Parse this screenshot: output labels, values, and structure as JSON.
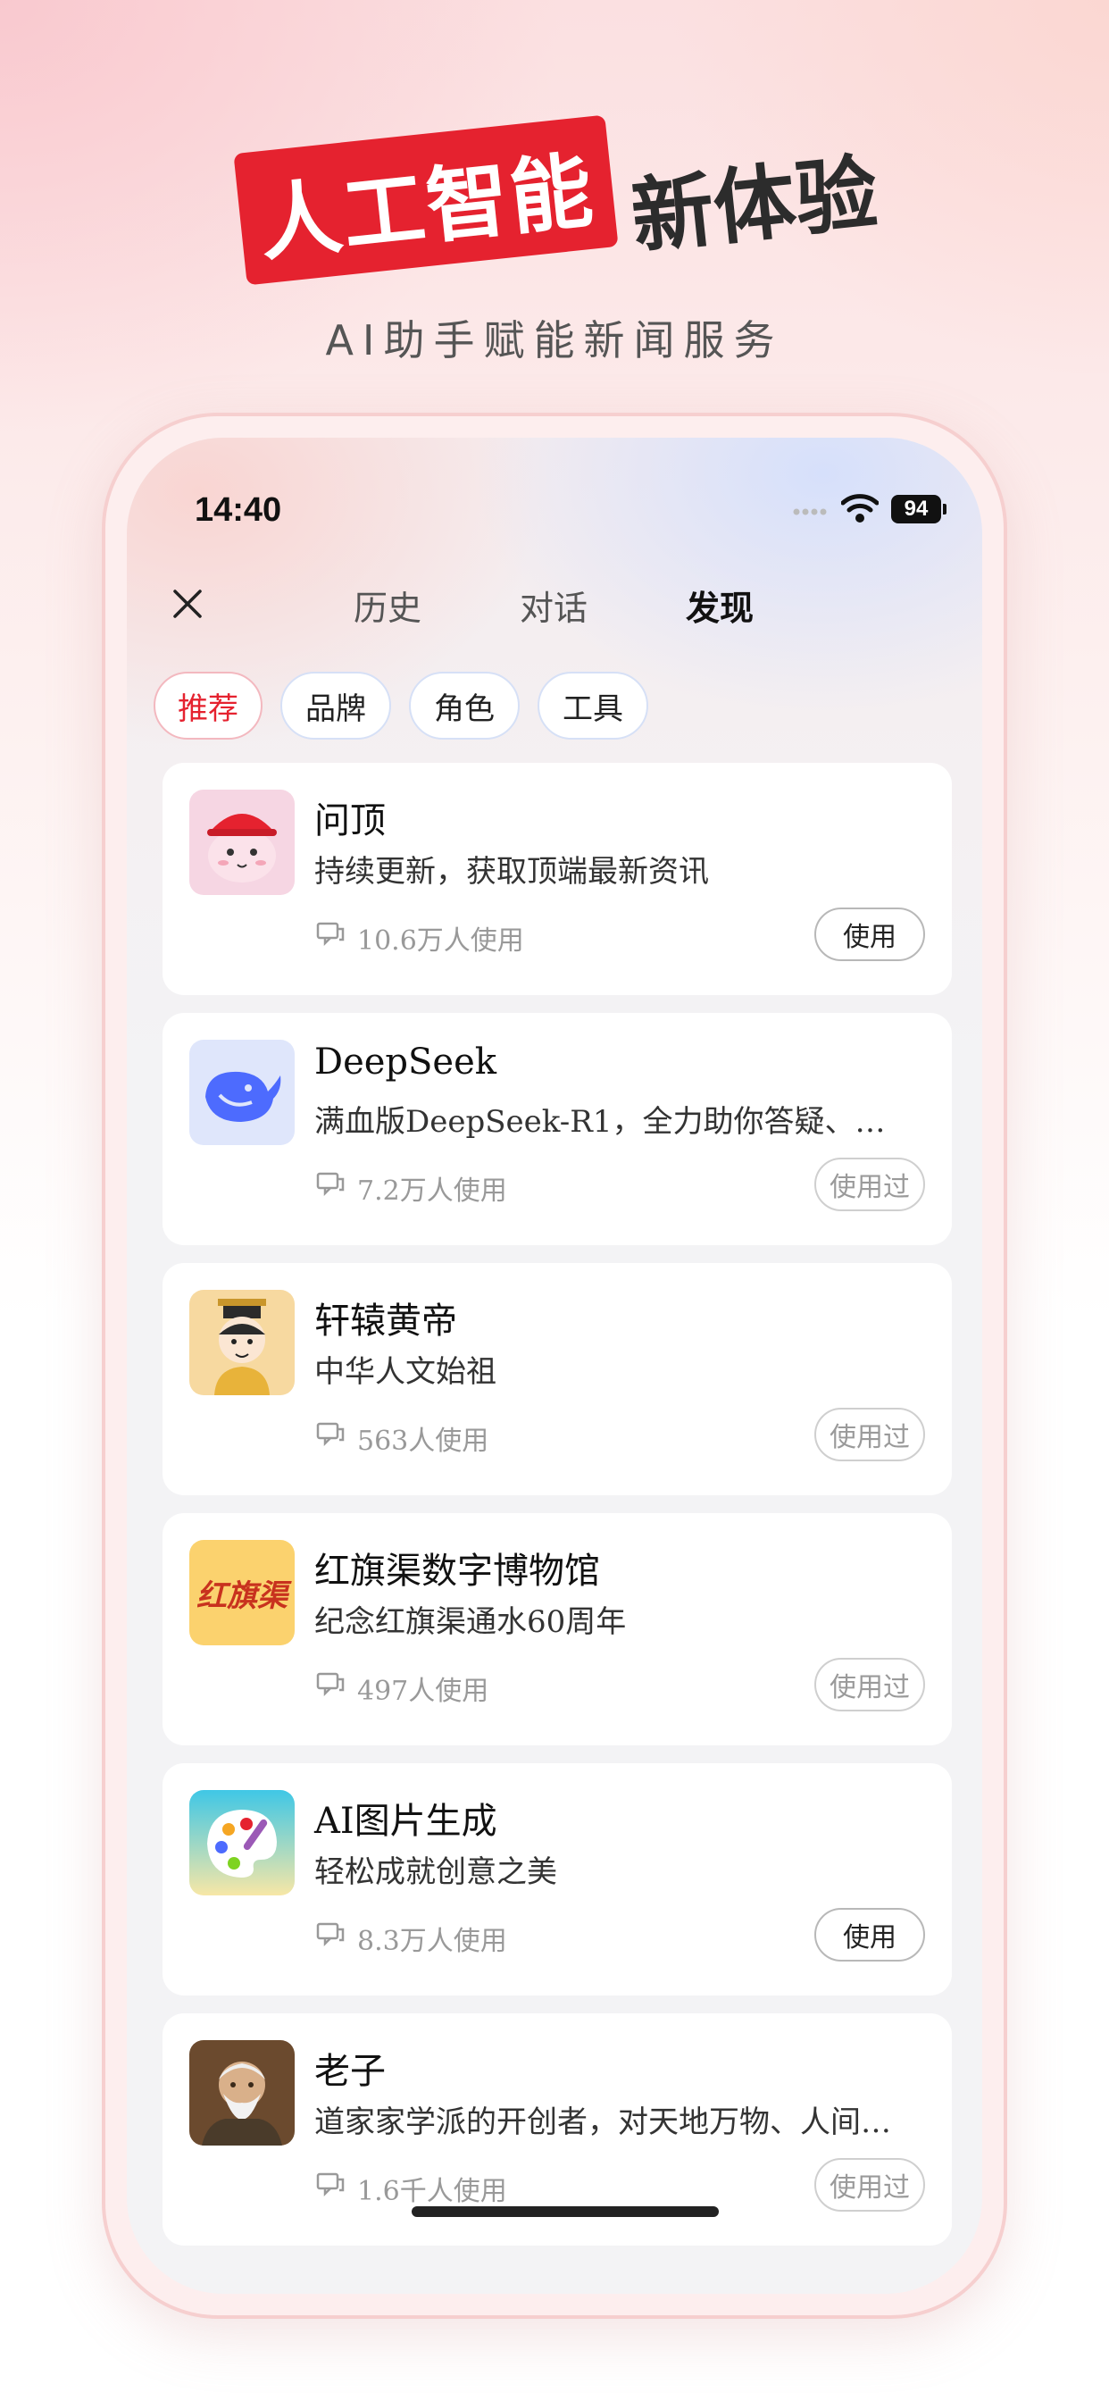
{
  "headline": {
    "banner": "人工智能",
    "right": "新体验",
    "subtitle": "AI助手赋能新闻服务"
  },
  "status_bar": {
    "time": "14:40",
    "battery": "94"
  },
  "nav": {
    "tabs": [
      {
        "label": "历史"
      },
      {
        "label": "对话"
      },
      {
        "label": "发现",
        "active": true
      }
    ]
  },
  "chips": [
    {
      "label": "推荐",
      "active": true
    },
    {
      "label": "品牌"
    },
    {
      "label": "角色"
    },
    {
      "label": "工具"
    }
  ],
  "cards": [
    {
      "title": "问顶",
      "desc": "持续更新，获取顶端最新资讯",
      "usage": "10.6万人使用",
      "button": "使用",
      "icon": "wending-mascot-icon"
    },
    {
      "title": "DeepSeek",
      "desc": "满血版DeepSeek-R1，全力助你答疑、…",
      "usage": "7.2万人使用",
      "button": "使用过",
      "icon": "deepseek-whale-icon"
    },
    {
      "title": "轩辕黄帝",
      "desc": "中华人文始祖",
      "usage": "563人使用",
      "button": "使用过",
      "icon": "huangdi-avatar-icon"
    },
    {
      "title": "红旗渠数字博物馆",
      "desc": "纪念红旗渠通水60周年",
      "usage": "497人使用",
      "button": "使用过",
      "icon": "hongqiqu-logo-icon",
      "logo_text": "红旗渠"
    },
    {
      "title": "AI图片生成",
      "desc": "轻松成就创意之美",
      "usage": "8.3万人使用",
      "button": "使用",
      "icon": "palette-icon"
    },
    {
      "title": "老子",
      "desc": "道家家学派的开创者，对天地万物、人间…",
      "usage": "1.6千人使用",
      "button": "使用过",
      "icon": "laozi-portrait-icon"
    }
  ],
  "colors": {
    "brand_red": "#e5222f",
    "deepseek_blue": "#4d6bfe"
  }
}
